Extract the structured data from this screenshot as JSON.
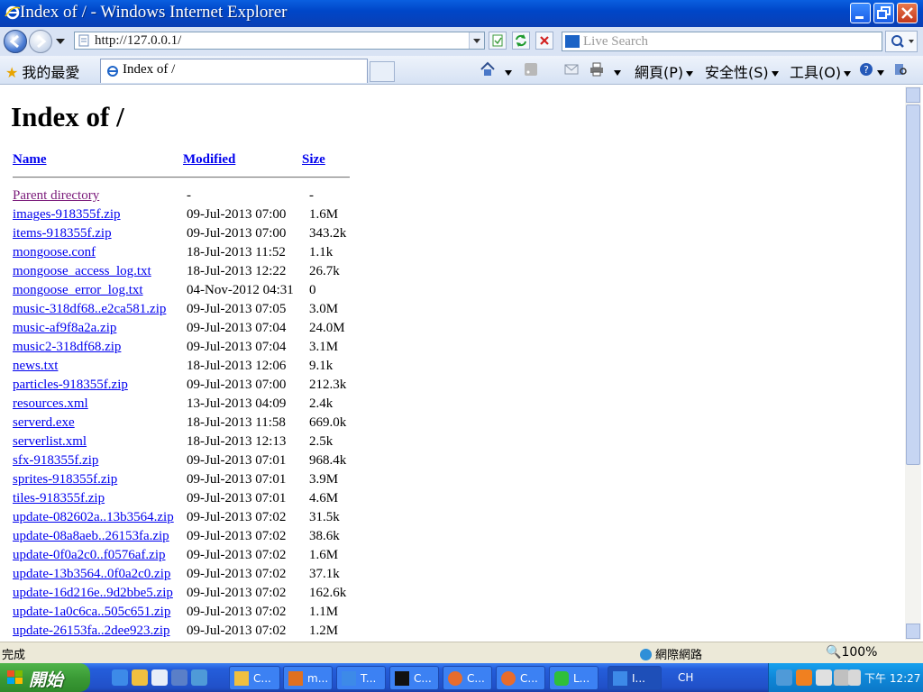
{
  "window": {
    "title": "Index of / - Windows Internet Explorer"
  },
  "addressbar": {
    "url": "http://127.0.0.1/",
    "search_placeholder": "Live Search"
  },
  "commandbar": {
    "favorites": "我的最愛",
    "tab_title": "Index of /",
    "page_menu": "網頁(P)",
    "safety_menu": "安全性(S)",
    "tools_menu": "工具(O)"
  },
  "page": {
    "heading": "Index of /",
    "columns": {
      "name": "Name",
      "modified": "Modified",
      "size": "Size"
    },
    "entries": [
      {
        "name": "Parent directory",
        "modified": "-",
        "size": "-"
      },
      {
        "name": "images-918355f.zip",
        "modified": "09-Jul-2013 07:00",
        "size": "1.6M"
      },
      {
        "name": "items-918355f.zip",
        "modified": "09-Jul-2013 07:00",
        "size": "343.2k"
      },
      {
        "name": "mongoose.conf",
        "modified": "18-Jul-2013 11:52",
        "size": "1.1k"
      },
      {
        "name": "mongoose_access_log.txt",
        "modified": "18-Jul-2013 12:22",
        "size": "26.7k"
      },
      {
        "name": "mongoose_error_log.txt",
        "modified": "04-Nov-2012 04:31",
        "size": "0"
      },
      {
        "name": "music-318df68..e2ca581.zip",
        "modified": "09-Jul-2013 07:05",
        "size": "3.0M"
      },
      {
        "name": "music-af9f8a2a.zip",
        "modified": "09-Jul-2013 07:04",
        "size": "24.0M"
      },
      {
        "name": "music2-318df68.zip",
        "modified": "09-Jul-2013 07:04",
        "size": "3.1M"
      },
      {
        "name": "news.txt",
        "modified": "18-Jul-2013 12:06",
        "size": "9.1k"
      },
      {
        "name": "particles-918355f.zip",
        "modified": "09-Jul-2013 07:00",
        "size": "212.3k"
      },
      {
        "name": "resources.xml",
        "modified": "13-Jul-2013 04:09",
        "size": "2.4k"
      },
      {
        "name": "serverd.exe",
        "modified": "18-Jul-2013 11:58",
        "size": "669.0k"
      },
      {
        "name": "serverlist.xml",
        "modified": "18-Jul-2013 12:13",
        "size": "2.5k"
      },
      {
        "name": "sfx-918355f.zip",
        "modified": "09-Jul-2013 07:01",
        "size": "968.4k"
      },
      {
        "name": "sprites-918355f.zip",
        "modified": "09-Jul-2013 07:01",
        "size": "3.9M"
      },
      {
        "name": "tiles-918355f.zip",
        "modified": "09-Jul-2013 07:01",
        "size": "4.6M"
      },
      {
        "name": "update-082602a..13b3564.zip",
        "modified": "09-Jul-2013 07:02",
        "size": "31.5k"
      },
      {
        "name": "update-08a8aeb..26153fa.zip",
        "modified": "09-Jul-2013 07:02",
        "size": "38.6k"
      },
      {
        "name": "update-0f0a2c0..f0576af.zip",
        "modified": "09-Jul-2013 07:02",
        "size": "1.6M"
      },
      {
        "name": "update-13b3564..0f0a2c0.zip",
        "modified": "09-Jul-2013 07:02",
        "size": "37.1k"
      },
      {
        "name": "update-16d216e..9d2bbe5.zip",
        "modified": "09-Jul-2013 07:02",
        "size": "162.6k"
      },
      {
        "name": "update-1a0c6ca..505c651.zip",
        "modified": "09-Jul-2013 07:02",
        "size": "1.1M"
      },
      {
        "name": "update-26153fa..2dee923.zip",
        "modified": "09-Jul-2013 07:02",
        "size": "1.2M"
      }
    ]
  },
  "statusbar": {
    "status": "完成",
    "zone": "網際網路",
    "zoom": "100%"
  },
  "taskbar": {
    "start": "開始",
    "tasks": [
      "C...",
      "m...",
      "T...",
      "C...",
      "C...",
      "C...",
      "L...",
      "I..."
    ],
    "language": "CH",
    "clock": "下午 12:27"
  }
}
